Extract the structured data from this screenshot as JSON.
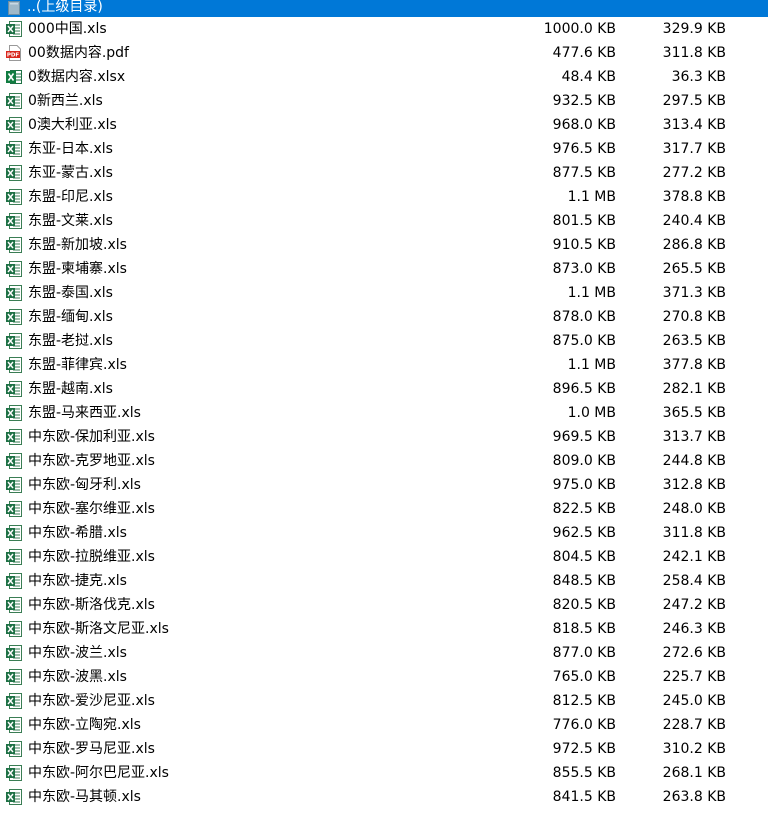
{
  "parent_dir": {
    "label": "..(上级目录)",
    "icon": "folder-up-icon"
  },
  "files": [
    {
      "name": "000中国.xls",
      "size": "1000.0 KB",
      "packed": "329.9 KB",
      "type": "xls"
    },
    {
      "name": "00数据内容.pdf",
      "size": "477.6 KB",
      "packed": "311.8 KB",
      "type": "pdf"
    },
    {
      "name": "0数据内容.xlsx",
      "size": "48.4 KB",
      "packed": "36.3 KB",
      "type": "xlsx"
    },
    {
      "name": "0新西兰.xls",
      "size": "932.5 KB",
      "packed": "297.5 KB",
      "type": "xls"
    },
    {
      "name": "0澳大利亚.xls",
      "size": "968.0 KB",
      "packed": "313.4 KB",
      "type": "xls"
    },
    {
      "name": "东亚-日本.xls",
      "size": "976.5 KB",
      "packed": "317.7 KB",
      "type": "xls"
    },
    {
      "name": "东亚-蒙古.xls",
      "size": "877.5 KB",
      "packed": "277.2 KB",
      "type": "xls"
    },
    {
      "name": "东盟-印尼.xls",
      "size": "1.1 MB",
      "packed": "378.8 KB",
      "type": "xls"
    },
    {
      "name": "东盟-文莱.xls",
      "size": "801.5 KB",
      "packed": "240.4 KB",
      "type": "xls"
    },
    {
      "name": "东盟-新加坡.xls",
      "size": "910.5 KB",
      "packed": "286.8 KB",
      "type": "xls"
    },
    {
      "name": "东盟-柬埔寨.xls",
      "size": "873.0 KB",
      "packed": "265.5 KB",
      "type": "xls"
    },
    {
      "name": "东盟-泰国.xls",
      "size": "1.1 MB",
      "packed": "371.3 KB",
      "type": "xls"
    },
    {
      "name": "东盟-缅甸.xls",
      "size": "878.0 KB",
      "packed": "270.8 KB",
      "type": "xls"
    },
    {
      "name": "东盟-老挝.xls",
      "size": "875.0 KB",
      "packed": "263.5 KB",
      "type": "xls"
    },
    {
      "name": "东盟-菲律宾.xls",
      "size": "1.1 MB",
      "packed": "377.8 KB",
      "type": "xls"
    },
    {
      "name": "东盟-越南.xls",
      "size": "896.5 KB",
      "packed": "282.1 KB",
      "type": "xls"
    },
    {
      "name": "东盟-马来西亚.xls",
      "size": "1.0 MB",
      "packed": "365.5 KB",
      "type": "xls"
    },
    {
      "name": "中东欧-保加利亚.xls",
      "size": "969.5 KB",
      "packed": "313.7 KB",
      "type": "xls"
    },
    {
      "name": "中东欧-克罗地亚.xls",
      "size": "809.0 KB",
      "packed": "244.8 KB",
      "type": "xls"
    },
    {
      "name": "中东欧-匈牙利.xls",
      "size": "975.0 KB",
      "packed": "312.8 KB",
      "type": "xls"
    },
    {
      "name": "中东欧-塞尔维亚.xls",
      "size": "822.5 KB",
      "packed": "248.0 KB",
      "type": "xls"
    },
    {
      "name": "中东欧-希腊.xls",
      "size": "962.5 KB",
      "packed": "311.8 KB",
      "type": "xls"
    },
    {
      "name": "中东欧-拉脱维亚.xls",
      "size": "804.5 KB",
      "packed": "242.1 KB",
      "type": "xls"
    },
    {
      "name": "中东欧-捷克.xls",
      "size": "848.5 KB",
      "packed": "258.4 KB",
      "type": "xls"
    },
    {
      "name": "中东欧-斯洛伐克.xls",
      "size": "820.5 KB",
      "packed": "247.2 KB",
      "type": "xls"
    },
    {
      "name": "中东欧-斯洛文尼亚.xls",
      "size": "818.5 KB",
      "packed": "246.3 KB",
      "type": "xls"
    },
    {
      "name": "中东欧-波兰.xls",
      "size": "877.0 KB",
      "packed": "272.6 KB",
      "type": "xls"
    },
    {
      "name": "中东欧-波黑.xls",
      "size": "765.0 KB",
      "packed": "225.7 KB",
      "type": "xls"
    },
    {
      "name": "中东欧-爱沙尼亚.xls",
      "size": "812.5 KB",
      "packed": "245.0 KB",
      "type": "xls"
    },
    {
      "name": "中东欧-立陶宛.xls",
      "size": "776.0 KB",
      "packed": "228.7 KB",
      "type": "xls"
    },
    {
      "name": "中东欧-罗马尼亚.xls",
      "size": "972.5 KB",
      "packed": "310.2 KB",
      "type": "xls"
    },
    {
      "name": "中东欧-阿尔巴尼亚.xls",
      "size": "855.5 KB",
      "packed": "268.1 KB",
      "type": "xls"
    },
    {
      "name": "中东欧-马其顿.xls",
      "size": "841.5 KB",
      "packed": "263.8 KB",
      "type": "xls"
    }
  ],
  "colors": {
    "selection": "#0078d7",
    "excel_green": "#1e7145",
    "pdf_red": "#d9261c"
  }
}
